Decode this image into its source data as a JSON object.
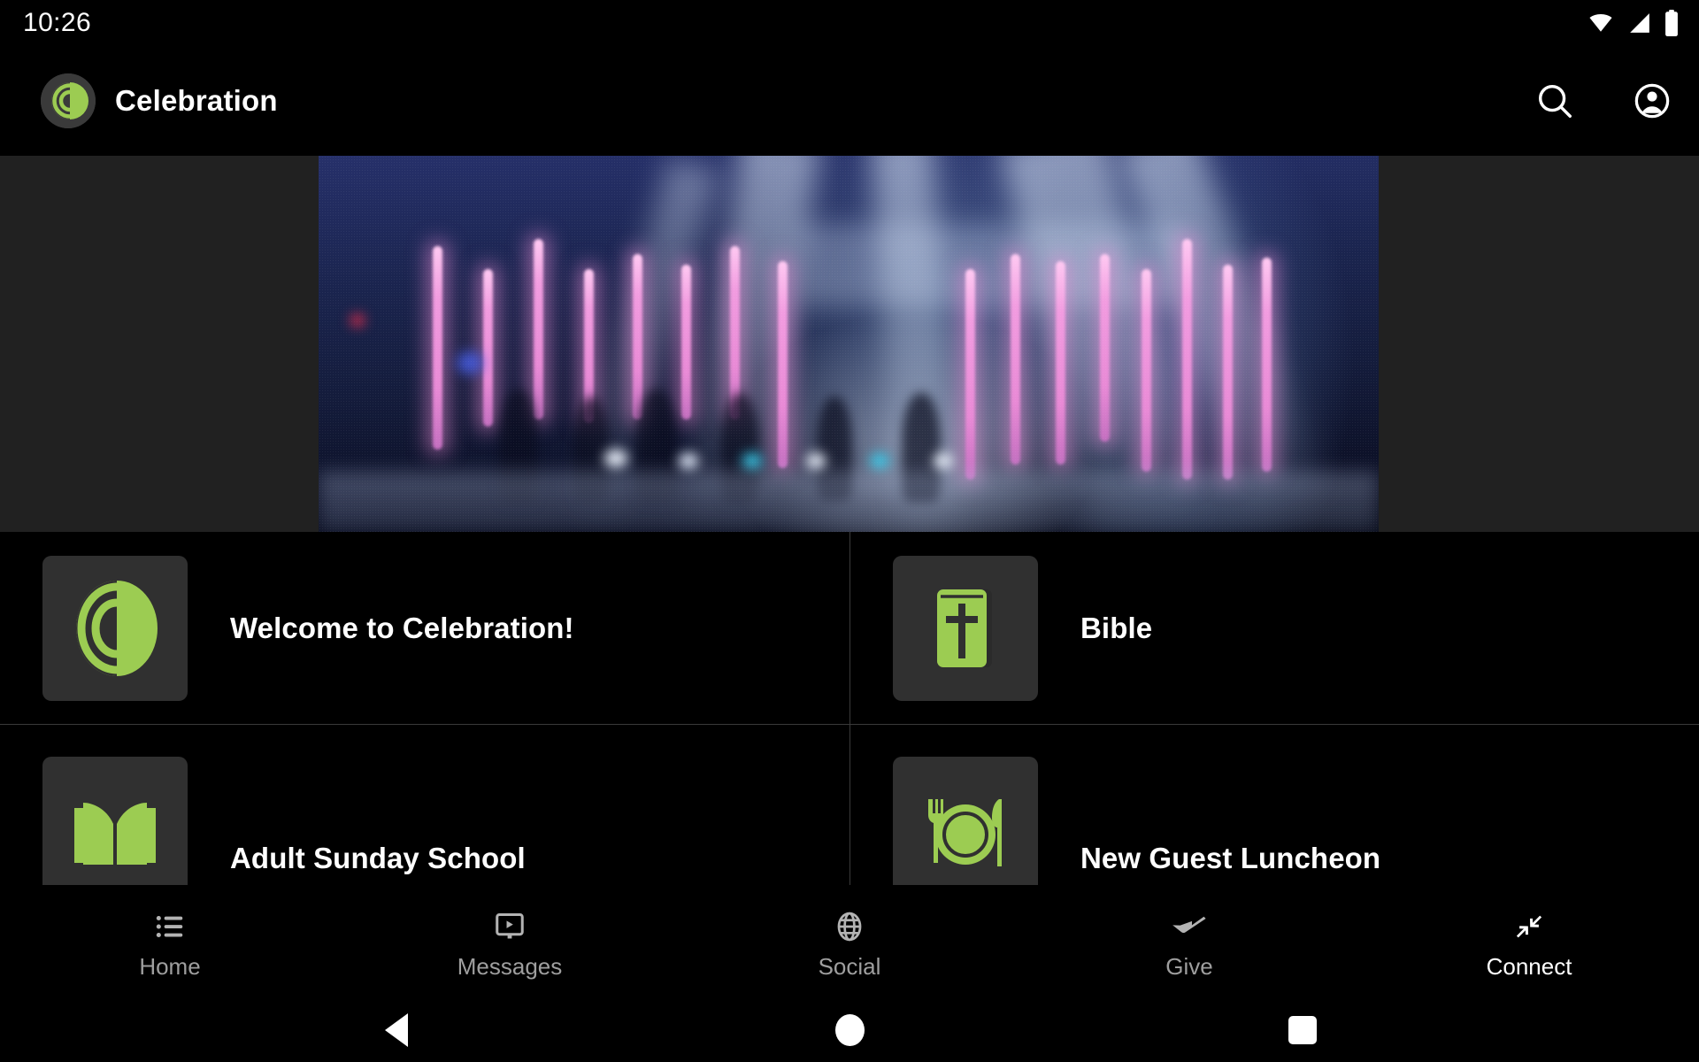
{
  "status_bar": {
    "clock": "10:26",
    "icons": [
      "wifi-icon",
      "cellular-signal-icon",
      "battery-icon"
    ]
  },
  "app_bar": {
    "logo_icon": "celebration-logo-icon",
    "title": "Celebration",
    "actions": [
      {
        "name": "search-icon",
        "label": "Search"
      },
      {
        "name": "account-circle-icon",
        "label": "Account"
      }
    ]
  },
  "hero": {
    "name": "worship-stage-banner-image",
    "description": "Blurred photo of a dark worship stage with pink LED tube lights and blue stage lighting"
  },
  "list": {
    "items": [
      {
        "icon": "celebration-logo-icon",
        "label": "Welcome to Celebration!"
      },
      {
        "icon": "bible-book-icon",
        "label": "Bible"
      },
      {
        "icon": "open-book-icon",
        "label": "Adult Sunday School"
      },
      {
        "icon": "plate-fork-knife-icon",
        "label": "New Guest Luncheon"
      }
    ]
  },
  "tab_bar": {
    "active": "Connect",
    "tabs": [
      {
        "icon": "list-bullet-icon",
        "label": "Home"
      },
      {
        "icon": "video-monitor-icon",
        "label": "Messages"
      },
      {
        "icon": "globe-icon",
        "label": "Social"
      },
      {
        "icon": "giving-hand-icon",
        "label": "Give"
      },
      {
        "icon": "connect-arrows-icon",
        "label": "Connect"
      }
    ]
  },
  "system_nav": {
    "back": "back-button",
    "home": "home-button",
    "recents": "recents-button"
  },
  "colors": {
    "accent_green": "#9ccc52",
    "tile_background": "#303030",
    "app_background": "#000000",
    "letterbox": "#212121",
    "divider": "#3a3a3a",
    "inactive_tab": "#9e9e9e"
  }
}
